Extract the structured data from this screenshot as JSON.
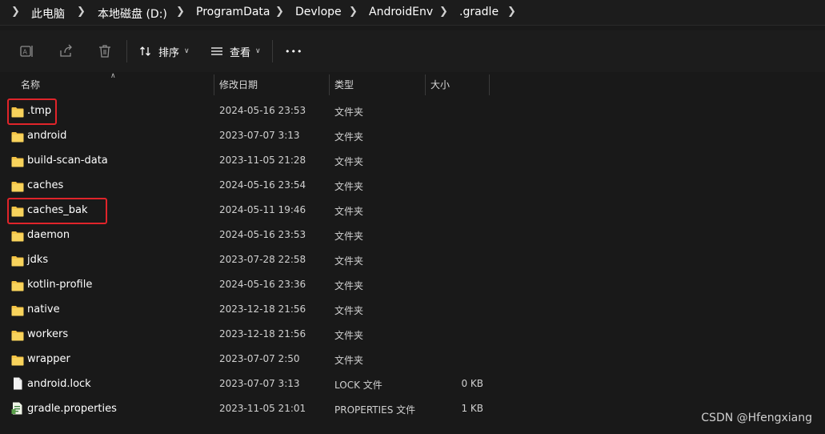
{
  "breadcrumb": {
    "items": [
      "此电脑",
      "本地磁盘 (D:)",
      "ProgramData",
      "Devlope",
      "AndroidEnv",
      ".gradle"
    ]
  },
  "toolbar": {
    "sort_label": "排序",
    "view_label": "查看",
    "more_label": "•••"
  },
  "columns": {
    "name": "名称",
    "modified": "修改日期",
    "type": "类型",
    "size": "大小"
  },
  "files": [
    {
      "name": ".tmp",
      "date": "2024-05-16 23:53",
      "type": "文件夹",
      "size": "",
      "kind": "folder"
    },
    {
      "name": "android",
      "date": "2023-07-07 3:13",
      "type": "文件夹",
      "size": "",
      "kind": "folder"
    },
    {
      "name": "build-scan-data",
      "date": "2023-11-05 21:28",
      "type": "文件夹",
      "size": "",
      "kind": "folder"
    },
    {
      "name": "caches",
      "date": "2024-05-16 23:54",
      "type": "文件夹",
      "size": "",
      "kind": "folder"
    },
    {
      "name": "caches_bak",
      "date": "2024-05-11 19:46",
      "type": "文件夹",
      "size": "",
      "kind": "folder"
    },
    {
      "name": "daemon",
      "date": "2024-05-16 23:53",
      "type": "文件夹",
      "size": "",
      "kind": "folder"
    },
    {
      "name": "jdks",
      "date": "2023-07-28 22:58",
      "type": "文件夹",
      "size": "",
      "kind": "folder"
    },
    {
      "name": "kotlin-profile",
      "date": "2024-05-16 23:36",
      "type": "文件夹",
      "size": "",
      "kind": "folder"
    },
    {
      "name": "native",
      "date": "2023-12-18 21:56",
      "type": "文件夹",
      "size": "",
      "kind": "folder"
    },
    {
      "name": "workers",
      "date": "2023-12-18 21:56",
      "type": "文件夹",
      "size": "",
      "kind": "folder"
    },
    {
      "name": "wrapper",
      "date": "2023-07-07 2:50",
      "type": "文件夹",
      "size": "",
      "kind": "folder"
    },
    {
      "name": "android.lock",
      "date": "2023-07-07 3:13",
      "type": "LOCK 文件",
      "size": "0 KB",
      "kind": "file"
    },
    {
      "name": "gradle.properties",
      "date": "2023-11-05 21:01",
      "type": "PROPERTIES 文件",
      "size": "1 KB",
      "kind": "properties"
    }
  ],
  "watermark": "CSDN @Hfengxiang",
  "colors": {
    "background": "#191919",
    "folder": "#f4c345",
    "highlight": "#e0242a"
  }
}
